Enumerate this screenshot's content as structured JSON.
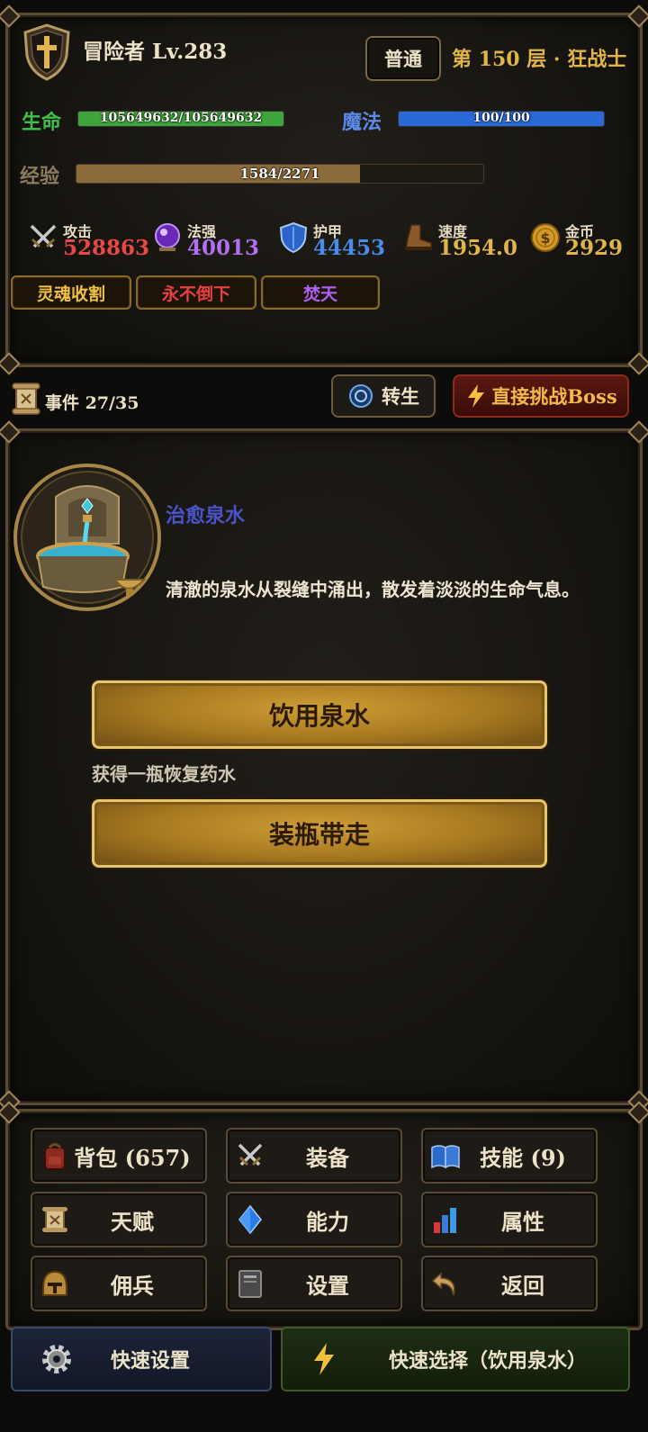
{
  "player": {
    "name": "冒险者 Lv.283",
    "difficulty": "普通",
    "floor": "第 150 层 · 狂战士"
  },
  "bars": {
    "hp": {
      "label": "生命",
      "text": "105649632/105649632",
      "fraction": 1.0,
      "color": "#3fa53a"
    },
    "mp": {
      "label": "魔法",
      "text": "100/100",
      "fraction": 1.0,
      "color": "#2a6ad8"
    },
    "exp": {
      "label": "经验",
      "text": "1584/2271",
      "fraction": 0.697,
      "color": "#8a6a3a"
    }
  },
  "stats": [
    {
      "name": "攻击",
      "value": "528863",
      "icon": "swords-icon",
      "color": "#e84848"
    },
    {
      "name": "法强",
      "value": "40013",
      "icon": "magic-orb-icon",
      "color": "#b070f0"
    },
    {
      "name": "护甲",
      "value": "44453",
      "icon": "shield-icon",
      "color": "#4a8ae8"
    },
    {
      "name": "速度",
      "value": "1954.0",
      "icon": "boot-icon",
      "color": "#e0b64a"
    },
    {
      "name": "金币",
      "value": "2929",
      "icon": "coin-icon",
      "color": "#e0b64a"
    }
  ],
  "tags": [
    {
      "label": "灵魂收割",
      "color": "#f0c040"
    },
    {
      "label": "永不倒下",
      "color": "#e84040"
    },
    {
      "label": "焚天",
      "color": "#b060f0"
    }
  ],
  "event_bar": {
    "count": "事件 27/35",
    "rebirth": "转生",
    "boss": "直接挑战Boss"
  },
  "event": {
    "title": "治愈泉水",
    "description": "清澈的泉水从裂缝中涌出，散发着淡淡的生命气息。",
    "choices": [
      {
        "label": "饮用泉水",
        "hint": "获得一瓶恢复药水"
      },
      {
        "label": "装瓶带走",
        "hint": ""
      }
    ]
  },
  "menu": [
    {
      "label": "背包 (657)",
      "icon": "backpack-icon"
    },
    {
      "label": "装备",
      "icon": "swords-icon"
    },
    {
      "label": "技能 (9)",
      "icon": "spellbook-icon"
    },
    {
      "label": "天赋",
      "icon": "scroll-icon"
    },
    {
      "label": "能力",
      "icon": "diamond-icon"
    },
    {
      "label": "属性",
      "icon": "bar-chart-icon"
    },
    {
      "label": "佣兵",
      "icon": "helmet-icon"
    },
    {
      "label": "设置",
      "icon": "book-icon"
    },
    {
      "label": "返回",
      "icon": "return-arrow-icon"
    }
  ],
  "quick": {
    "settings": "快速设置",
    "select": "快速选择（饮用泉水）"
  }
}
